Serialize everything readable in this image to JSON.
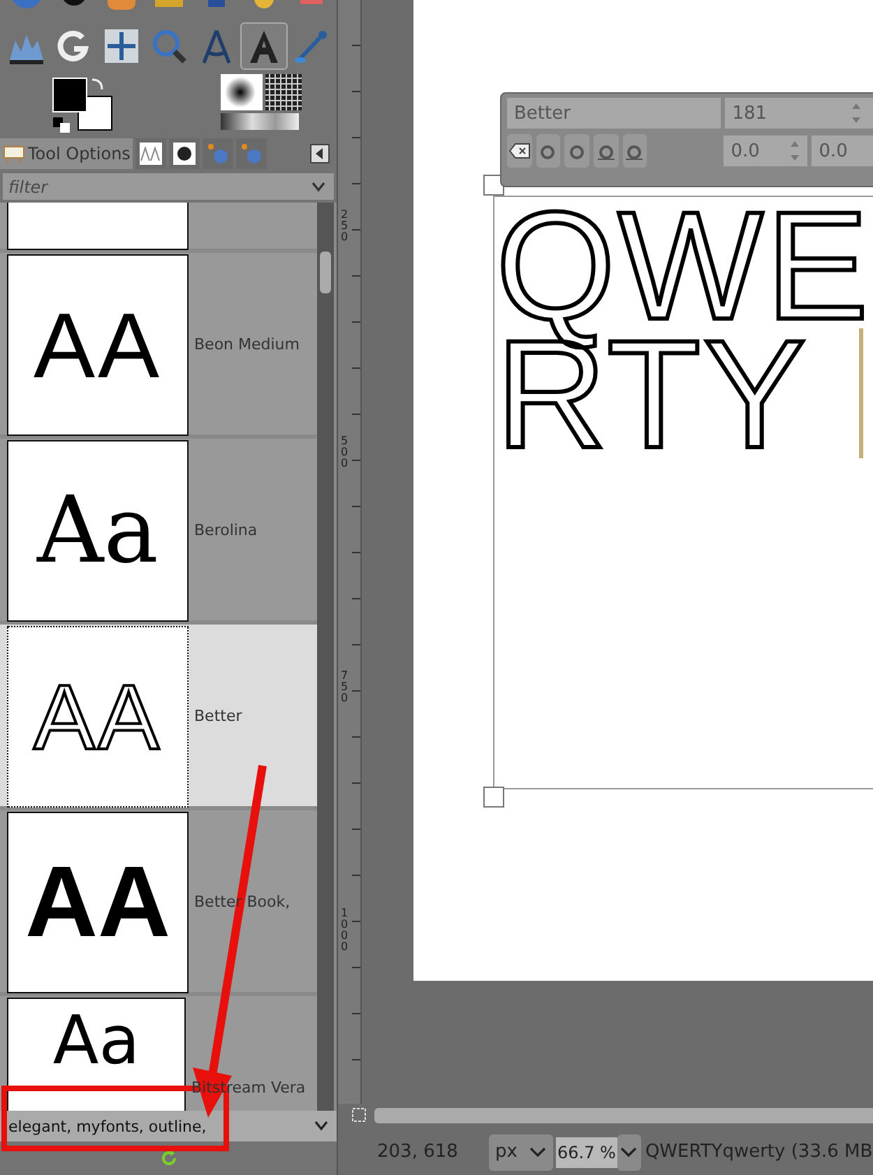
{
  "tools": [
    {
      "selected": false
    },
    {
      "selected": false
    },
    {
      "selected": false
    },
    {
      "selected": false
    },
    {
      "selected": false
    },
    {
      "selected": false
    },
    {
      "selected": false
    },
    {
      "selected": false
    },
    {
      "selected": false
    },
    {
      "selected": false
    },
    {
      "selected": false
    },
    {
      "selected": false
    },
    {
      "selected": true
    },
    {
      "selected": false
    }
  ],
  "tool_options": {
    "tabs": [
      {
        "label": "Tool Options",
        "selected": true
      },
      {
        "selected": false
      },
      {
        "selected": false
      },
      {
        "selected": false
      },
      {
        "selected": false
      }
    ]
  },
  "filter": {
    "placeholder": "filter"
  },
  "fonts": [
    {
      "name": "Beon Medium",
      "preview": "AA",
      "kind": "stroke",
      "selected": false
    },
    {
      "name": "Berolina",
      "preview": "Aa",
      "kind": "serif",
      "selected": false
    },
    {
      "name": "Better",
      "preview": "AA",
      "kind": "outline",
      "selected": true
    },
    {
      "name": "Better Book,",
      "preview": "AA",
      "kind": "heavy",
      "selected": false
    },
    {
      "name": "Bitstream Vera",
      "preview": "Aa",
      "kind": "sans",
      "selected": false
    }
  ],
  "tag_field": {
    "value": "elegant, myfonts, outline,"
  },
  "ruler": {
    "labels": [
      "250",
      "500",
      "750",
      "1000"
    ]
  },
  "text_toolbar": {
    "font": "Better",
    "size": "181",
    "baseline": "0.0",
    "kerning": "0.0"
  },
  "canvas": {
    "text_lines": [
      "QWE",
      "RTY"
    ]
  },
  "status_bar": {
    "pointer": "203, 618",
    "unit": "px",
    "zoom": "66.7 %",
    "title": "QWERTYqwerty (33.6 MB"
  }
}
